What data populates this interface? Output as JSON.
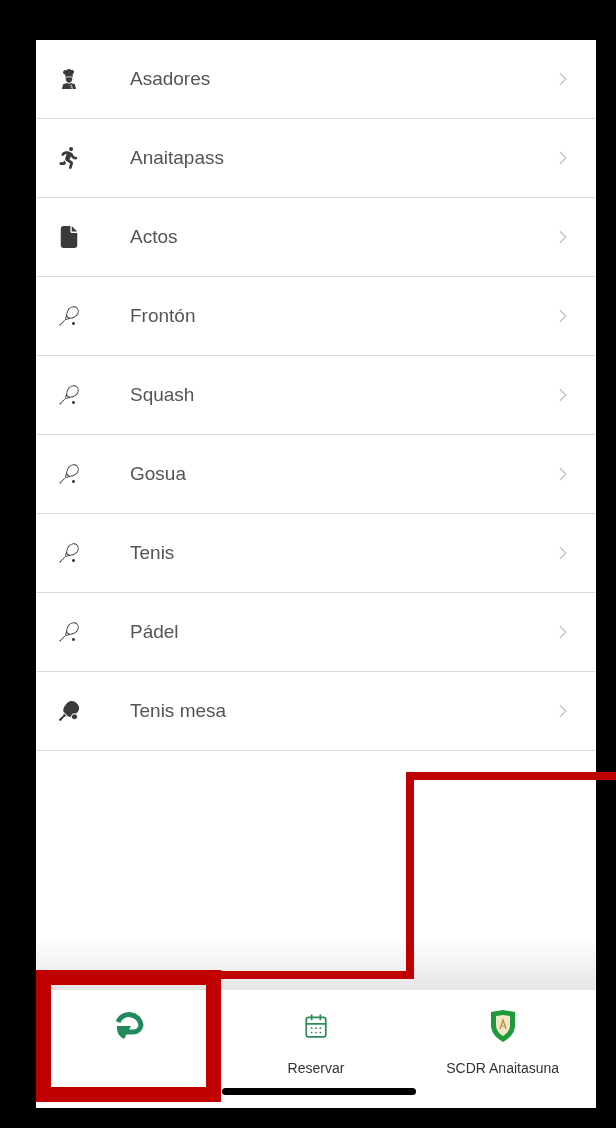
{
  "menu": [
    {
      "label": "Asadores"
    },
    {
      "label": "Anaitapass"
    },
    {
      "label": "Actos"
    },
    {
      "label": "Frontón"
    },
    {
      "label": "Squash"
    },
    {
      "label": "Gosua"
    },
    {
      "label": "Tenis"
    },
    {
      "label": "Pádel"
    },
    {
      "label": "Tenis mesa"
    }
  ],
  "tab_bar": [
    {
      "kind": "logo"
    },
    {
      "kind": "calendar",
      "label": "Reservar"
    },
    {
      "kind": "shield",
      "label": "SCDR Anaitasuna"
    }
  ]
}
